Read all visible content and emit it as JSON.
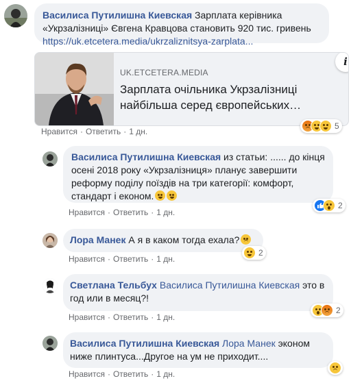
{
  "colors": {
    "link": "#385898",
    "bubble": "#f0f2f5",
    "meta": "#65676b"
  },
  "actions": {
    "like": "Нравится",
    "reply": "Ответить",
    "dot": "·"
  },
  "top_comment": {
    "author": "Василиса Путилишна Киевская",
    "text": "Зарплата керівника «Укрзалізниці» Євгена Кравцова становить 920 тис. гривень",
    "link": "https://uk.etcetera.media/ukrzaliznitsya-zarplata...",
    "time": "1 дн.",
    "reactions": {
      "icons": [
        "angry",
        "haha",
        "haha"
      ],
      "count": "5"
    }
  },
  "link_card": {
    "domain": "UK.ETCETERA.MEDIA",
    "title": "Зарплата очільника Укрзалізниці найбільша серед європейських…",
    "info_icon": "info-icon"
  },
  "replies": [
    {
      "author": "Василиса Путилишна Киевская",
      "text": "из статьи: ...... до кінця осені 2018 року «Укрзалізниця» планує завершити реформу поділу поїздів на три категорії: комфорт, стандарт і економ.",
      "emoji": [
        "haha",
        "haha"
      ],
      "time": "1 дн.",
      "reactions": {
        "icons": [
          "like",
          "wow"
        ],
        "count": "2"
      }
    },
    {
      "author": "Лора Манек",
      "text": "А я в каком тогда ехала?",
      "emoji": [
        "thinking"
      ],
      "time": "1 дн.",
      "reactions": {
        "icons": [
          "haha"
        ],
        "count": "2"
      }
    },
    {
      "author": "Светлана Тельбух",
      "mention": "Василиса Путилишна Киевская",
      "text": "это в год или в месяц?!",
      "time": "1 дн.",
      "reactions": {
        "icons": [
          "wow",
          "angry"
        ],
        "count": "2"
      }
    },
    {
      "author": "Василиса Путилишна Киевская",
      "mention": "Лора Манек",
      "text": "эконом ниже плинтуса...Другое на ум не приходит....",
      "time": "1 дн.",
      "reactions": {
        "icons": [
          "sad"
        ],
        "count": ""
      }
    }
  ]
}
